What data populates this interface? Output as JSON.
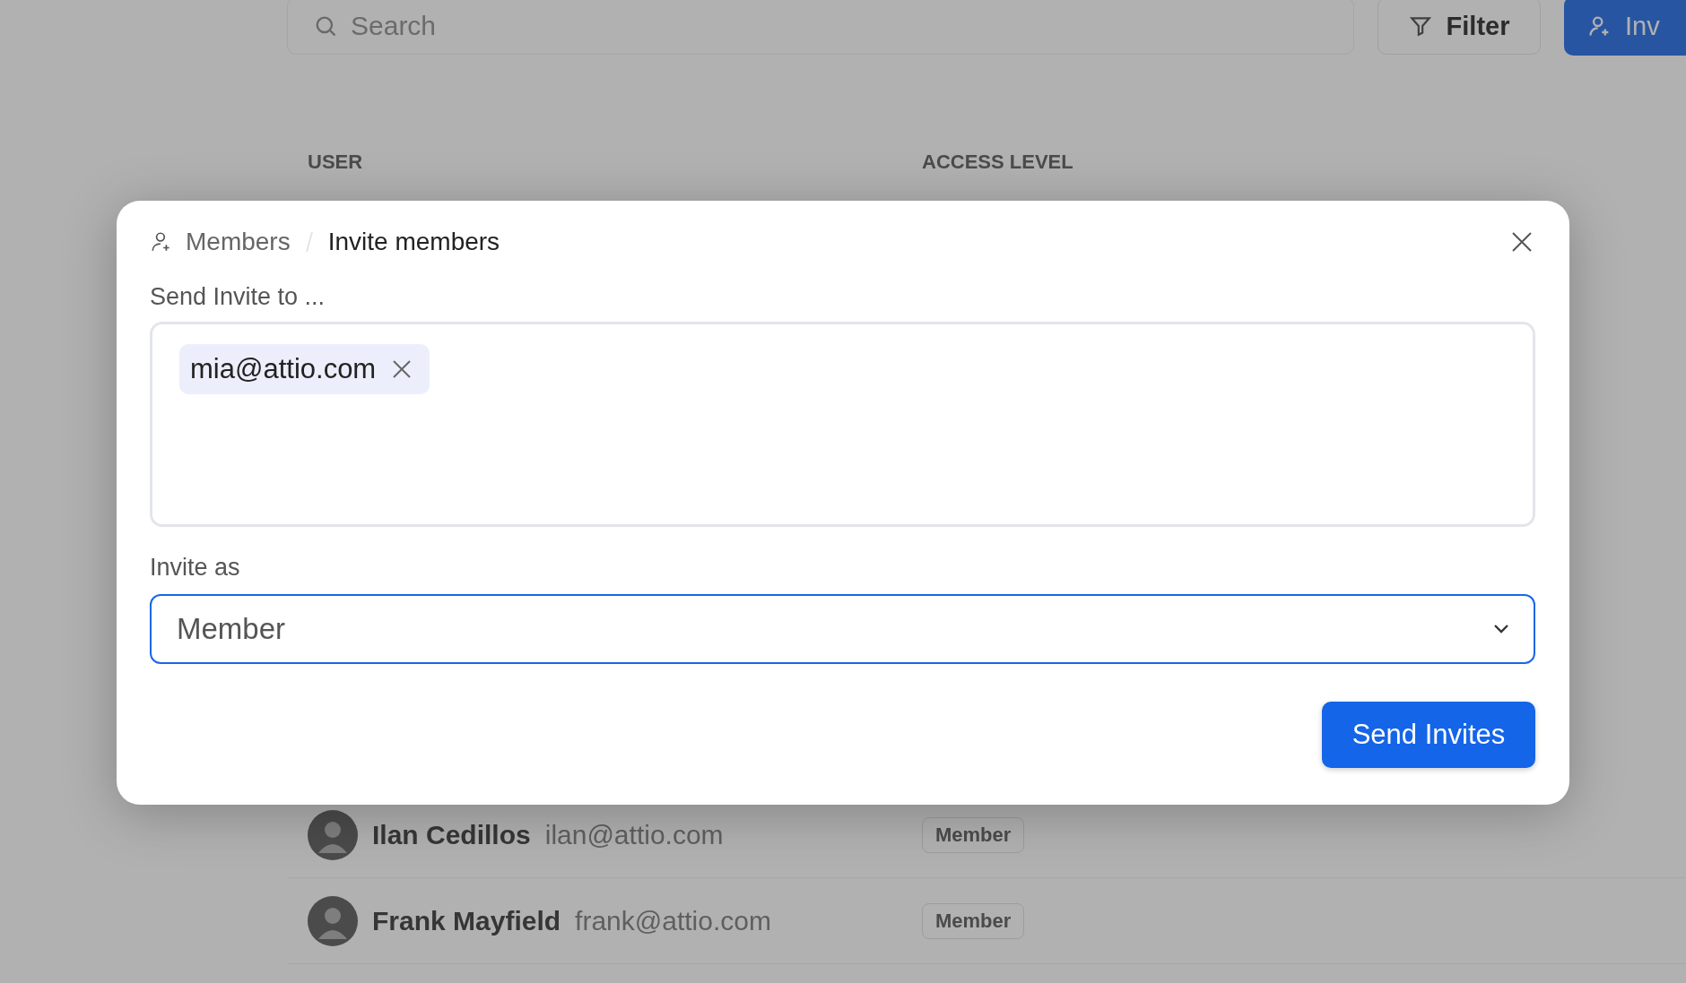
{
  "toolbar": {
    "search": {
      "placeholder": "Search"
    },
    "filter_button": "Filter",
    "invite_button": "Inv"
  },
  "table": {
    "columns": [
      "USER",
      "ACCESS LEVEL"
    ],
    "rows": [
      {
        "name": "Ilan Cedillos",
        "email": "ilan@attio.com",
        "access": "Member"
      },
      {
        "name": "Frank Mayfield",
        "email": "frank@attio.com",
        "access": "Member"
      }
    ]
  },
  "modal": {
    "breadcrumb": [
      "Members",
      "Invite members"
    ],
    "recipients_label": "Send Invite to ...",
    "recipients": [
      "mia@attio.com"
    ],
    "role_label": "Invite as",
    "role": "Member",
    "submit": "Send Invites"
  }
}
